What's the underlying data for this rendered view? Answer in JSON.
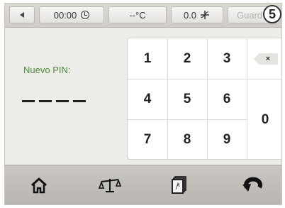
{
  "statusbar": {
    "back_icon": "left-arrow-icon",
    "time": "00:00",
    "time_icon": "clock-icon",
    "temperature": "--°C",
    "flow": "0.0",
    "flow_icon": "fan-icon",
    "save_label": "Guard",
    "step_badge": "5"
  },
  "pin": {
    "label": "Nuevo PIN:",
    "placeholder_dashes": 4
  },
  "keypad": {
    "keys": [
      "1",
      "2",
      "3",
      "4",
      "5",
      "6",
      "7",
      "8",
      "9",
      "0"
    ],
    "delete_icon": "backspace-icon",
    "delete_glyph": "×"
  },
  "navbar": {
    "items": [
      "home-icon",
      "scale-icon",
      "recipe-book-icon",
      "undo-icon"
    ]
  },
  "colors": {
    "accent_green": "#4b8a3c",
    "background": "#eeece9"
  }
}
